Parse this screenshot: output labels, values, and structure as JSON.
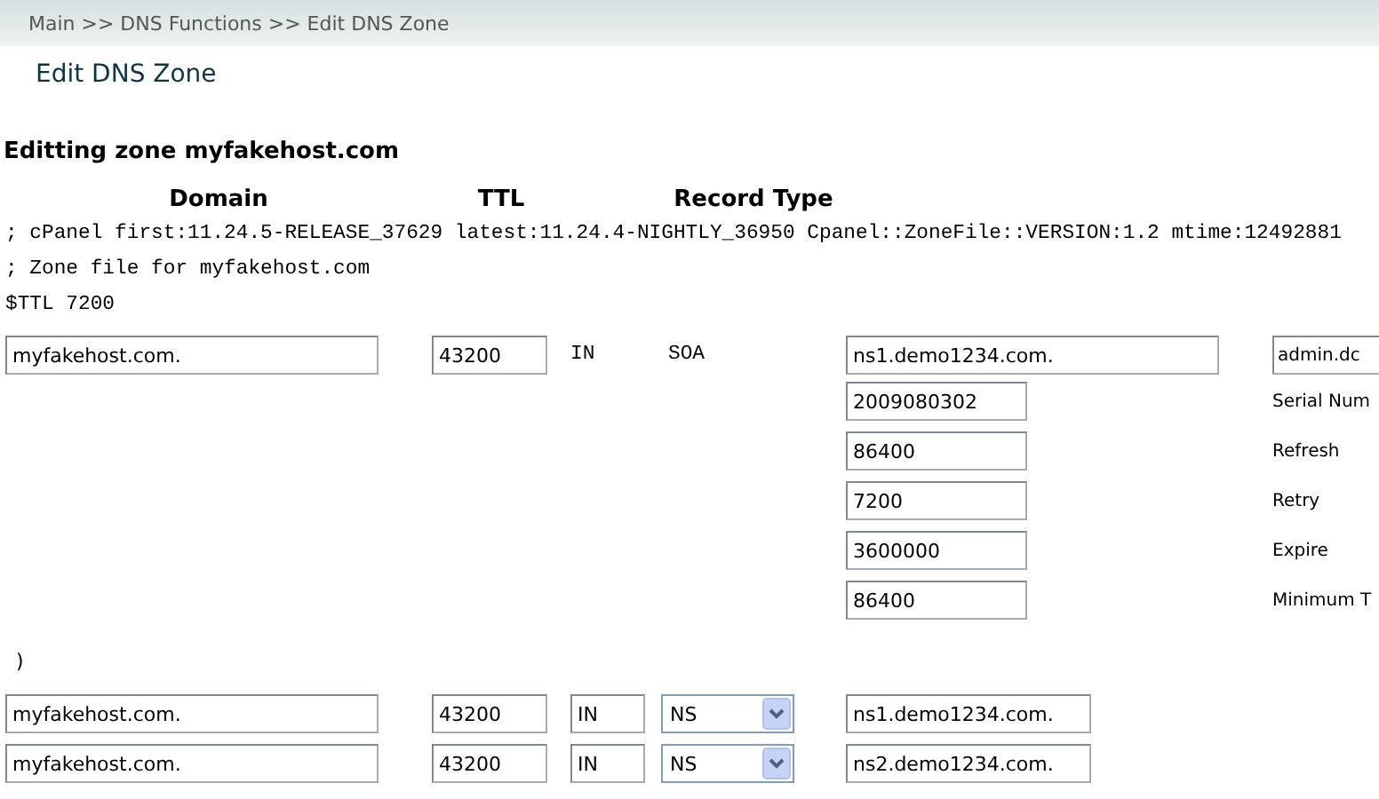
{
  "breadcrumb": "Main >> DNS Functions >> Edit DNS Zone",
  "page_title": "Edit DNS Zone",
  "zone_heading": "Editting zone myfakehost.com",
  "columns": [
    "Domain",
    "TTL",
    "Record Type"
  ],
  "comments": [
    "; cPanel first:11.24.5-RELEASE_37629 latest:11.24.4-NIGHTLY_36950 Cpanel::ZoneFile::VERSION:1.2 mtime:12492881",
    "; Zone file for myfakehost.com",
    "$TTL 7200"
  ],
  "soa": {
    "domain": "myfakehost.com.",
    "ttl": "43200",
    "class": "IN",
    "type": "SOA",
    "primary_ns": "ns1.demo1234.com.",
    "admin": "admin.dc",
    "fields": [
      {
        "value": "2009080302",
        "label": "Serial Num"
      },
      {
        "value": "86400",
        "label": "Refresh"
      },
      {
        "value": "7200",
        "label": "Retry"
      },
      {
        "value": "3600000",
        "label": "Expire"
      },
      {
        "value": "86400",
        "label": "Minimum T"
      }
    ],
    "close": ")"
  },
  "records": [
    {
      "domain": "myfakehost.com.",
      "ttl": "43200",
      "class": "IN",
      "type": "NS",
      "value": "ns1.demo1234.com."
    },
    {
      "domain": "myfakehost.com.",
      "ttl": "43200",
      "class": "IN",
      "type": "NS",
      "value": "ns2.demo1234.com."
    }
  ]
}
